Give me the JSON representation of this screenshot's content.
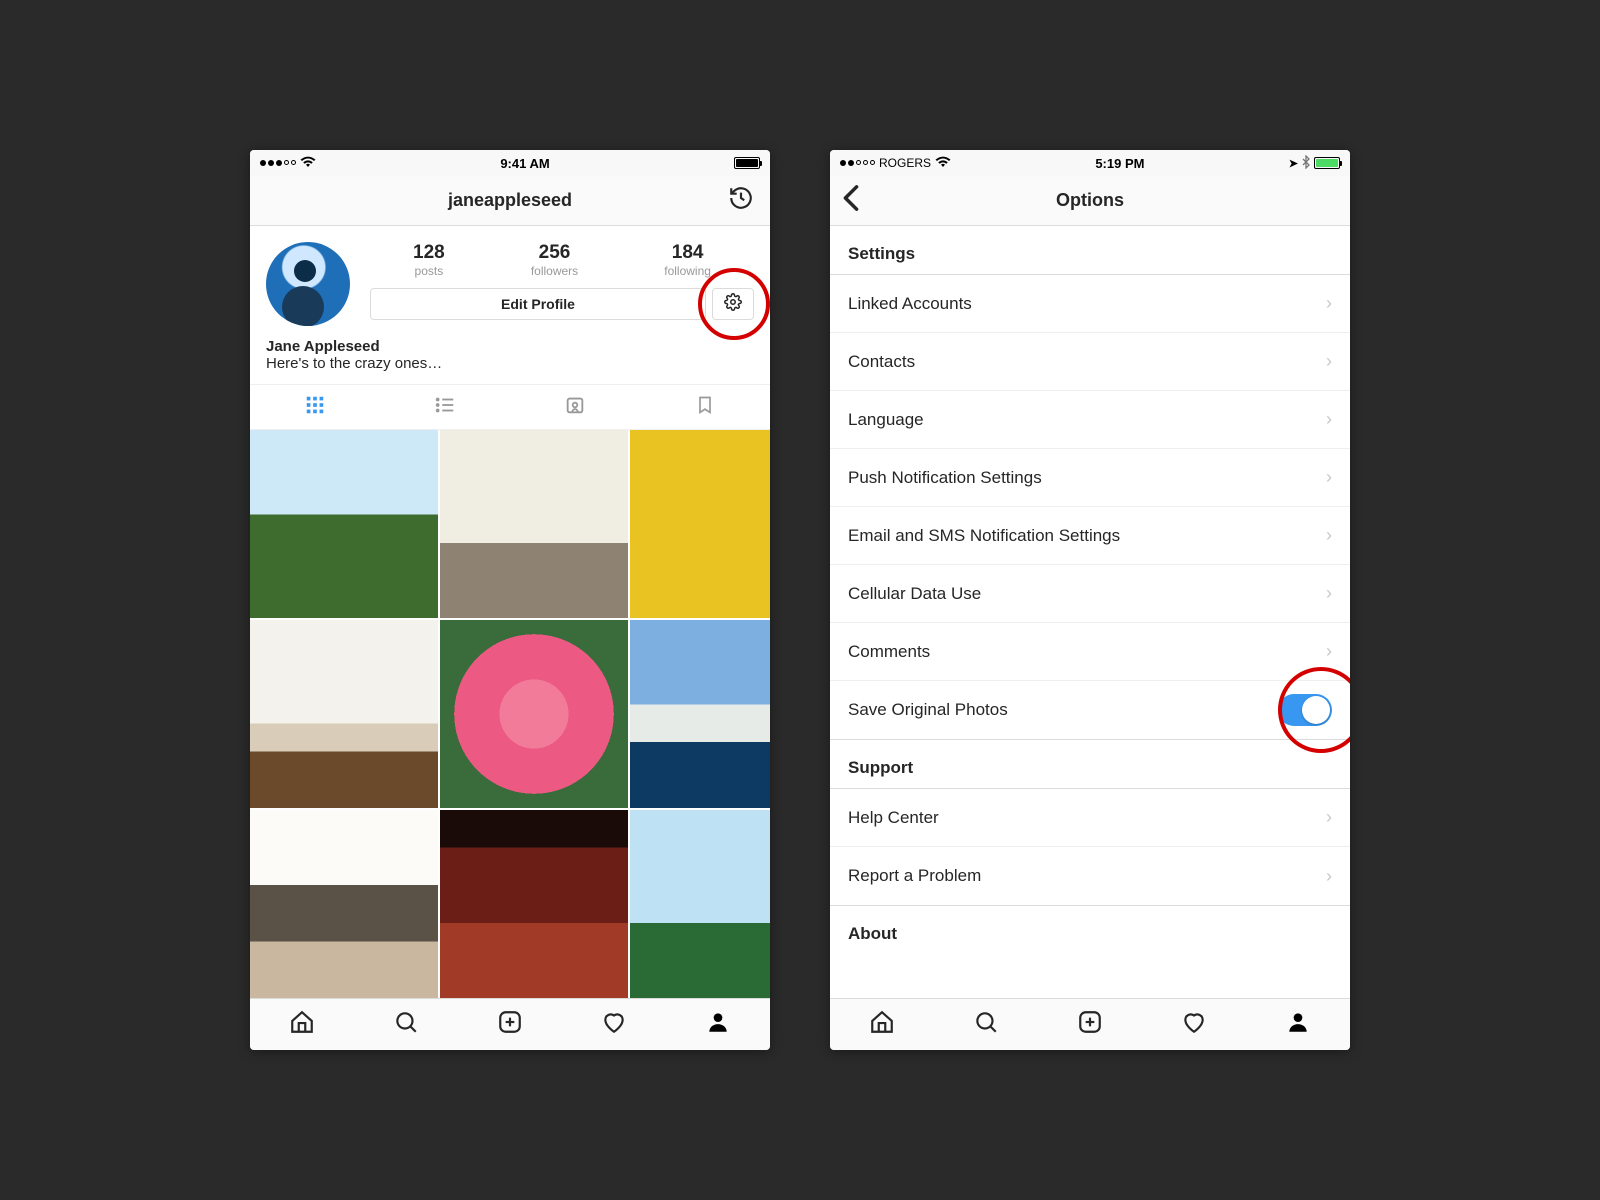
{
  "left": {
    "status": {
      "time": "9:41 AM"
    },
    "nav": {
      "title": "janeappleseed"
    },
    "stats": {
      "posts_num": "128",
      "posts_lbl": "posts",
      "followers_num": "256",
      "followers_lbl": "followers",
      "following_num": "184",
      "following_lbl": "following"
    },
    "edit_profile": "Edit Profile",
    "bio": {
      "name": "Jane Appleseed",
      "text": "Here's to the crazy ones…"
    }
  },
  "right": {
    "status": {
      "carrier": "ROGERS",
      "time": "5:19 PM"
    },
    "nav": {
      "title": "Options"
    },
    "sections": {
      "settings_header": "Settings",
      "items": [
        "Linked Accounts",
        "Contacts",
        "Language",
        "Push Notification Settings",
        "Email and SMS Notification Settings",
        "Cellular Data Use",
        "Comments"
      ],
      "save_original": "Save Original Photos",
      "support_header": "Support",
      "support_items": [
        "Help Center",
        "Report a Problem"
      ],
      "about_header": "About"
    }
  }
}
